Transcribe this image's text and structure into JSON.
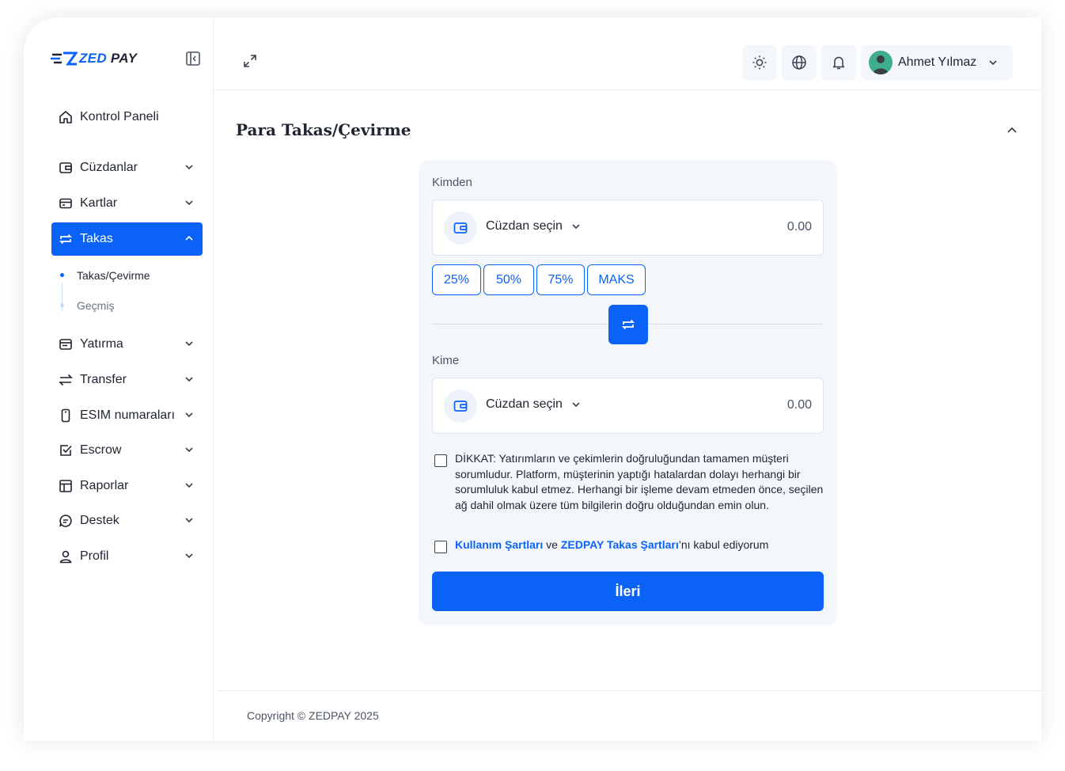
{
  "brand": {
    "logo_text_accent": "ZED",
    "logo_text_rest": " PAY",
    "accent_color": "#0a63f6"
  },
  "sidebar": {
    "items": [
      {
        "label": "Kontrol Paneli",
        "icon": "home-icon"
      },
      {
        "label": "Cüzdanlar",
        "icon": "wallet-icon"
      },
      {
        "label": "Kartlar",
        "icon": "credit-card-icon"
      },
      {
        "label": "Takas",
        "icon": "swap-icon",
        "active": true
      },
      {
        "label": "Yatırma",
        "icon": "deposit-icon"
      },
      {
        "label": "Transfer",
        "icon": "transfer-arrows-icon"
      },
      {
        "label": "ESIM numaraları",
        "icon": "phone-icon"
      },
      {
        "label": "Escrow",
        "icon": "checkbox-icon"
      },
      {
        "label": "Raporlar",
        "icon": "table-icon"
      },
      {
        "label": "Destek",
        "icon": "chat-icon"
      },
      {
        "label": "Profil",
        "icon": "user-icon"
      }
    ],
    "sub_items": [
      {
        "label": "Takas/Çevirme",
        "active": true
      },
      {
        "label": "Geçmiş",
        "active": false
      }
    ]
  },
  "header": {
    "user_name": "Ahmet Yılmaz"
  },
  "page": {
    "title": "Para Takas/Çevirme"
  },
  "exchange": {
    "from_label": "Kimden",
    "to_label": "Kime",
    "wallet_placeholder": "Cüzdan seçin",
    "from_amount": "0.00",
    "to_amount": "0.00",
    "percent_buttons": [
      "25%",
      "50%",
      "75%",
      "MAKS"
    ],
    "warning_text": "DİKKAT: Yatırımların ve çekimlerin doğruluğundan tamamen müşteri sorumludur. Platform, müşterinin yaptığı hatalardan dolayı herhangi bir sorumluluk kabul etmez. Herhangi bir işleme devam etmeden önce, seçilen ağ dahil olmak üzere tüm bilgilerin doğru olduğundan emin olun.",
    "terms_link_1": "Kullanım Şartları",
    "terms_and": " ve ",
    "terms_link_2": "ZEDPAY Takas Şartları",
    "terms_suffix": "’nı kabul ediyorum",
    "next_button": "İleri"
  },
  "footer": {
    "copyright": "Copyright © ZEDPAY 2025"
  }
}
